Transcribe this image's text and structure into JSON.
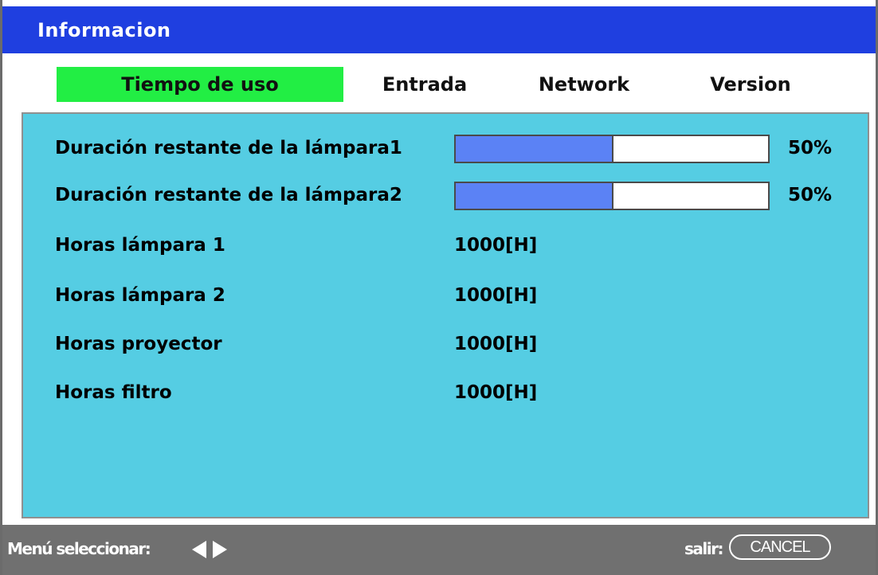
{
  "window": {
    "title": "Informacion"
  },
  "tabs": [
    {
      "label": "Tiempo de uso",
      "active": true
    },
    {
      "label": "Entrada",
      "active": false
    },
    {
      "label": "Network",
      "active": false
    },
    {
      "label": "Version",
      "active": false
    }
  ],
  "lamp_life": [
    {
      "label": "Duración restante de la lámpara1",
      "percent_text": "50%",
      "fill_fraction": 0.5
    },
    {
      "label": "Duración restante de la lámpara2",
      "percent_text": "50%",
      "fill_fraction": 0.5
    }
  ],
  "hours": [
    {
      "label": "Horas lámpara 1",
      "value": "1000[H]"
    },
    {
      "label": "Horas lámpara 2",
      "value": "1000[H]"
    },
    {
      "label": "Horas proyector",
      "value": "1000[H]"
    },
    {
      "label": "Horas filtro",
      "value": "1000[H]"
    }
  ],
  "footer": {
    "select_label": "Menú seleccionar:",
    "exit_label": "salir:",
    "cancel_label": "CANCEL"
  },
  "colors": {
    "title_bar": "#1f3fe0",
    "active_tab": "#22ee44",
    "panel": "#55cde3",
    "bar_fill": "#5b82f5",
    "footer": "#707070"
  }
}
